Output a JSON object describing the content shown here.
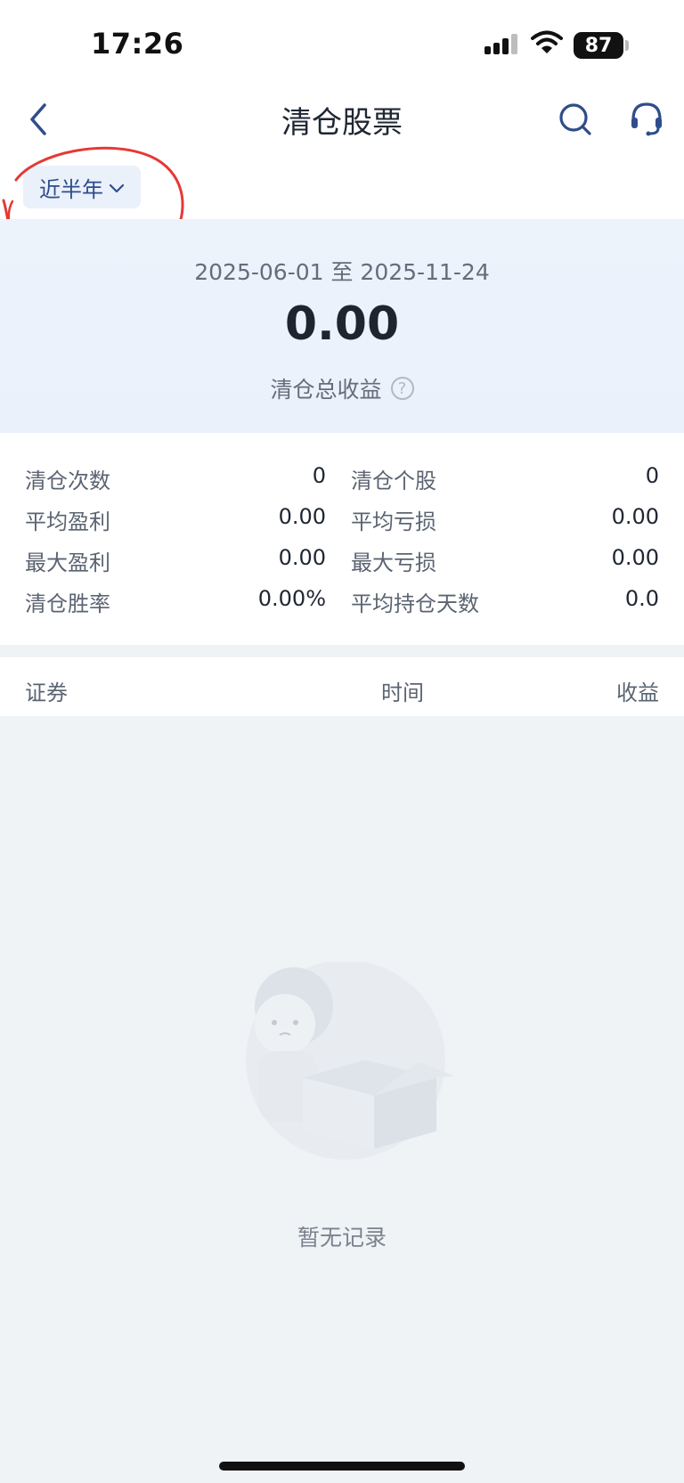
{
  "status_bar": {
    "time": "17:26",
    "battery": "87",
    "icons": [
      "signal-icon",
      "wifi-icon",
      "battery-icon"
    ]
  },
  "nav": {
    "title": "清仓股票",
    "icons": [
      "back-icon",
      "search-icon",
      "headset-service-icon"
    ]
  },
  "filter": {
    "period_label": "近半年",
    "dropdown_icon": "chevron-down-icon"
  },
  "summary": {
    "date_range": "2025-06-01 至 2025-11-24",
    "total_value": "0.00",
    "total_label": "清仓总收益",
    "help_glyph": "?"
  },
  "stats": [
    {
      "label": "清仓次数",
      "value": "0"
    },
    {
      "label": "清仓个股",
      "value": "0"
    },
    {
      "label": "平均盈利",
      "value": "0.00"
    },
    {
      "label": "平均亏损",
      "value": "0.00"
    },
    {
      "label": "最大盈利",
      "value": "0.00"
    },
    {
      "label": "最大亏损",
      "value": "0.00"
    },
    {
      "label": "清仓胜率",
      "value": "0.00%"
    },
    {
      "label": "平均持仓天数",
      "value": "0.0"
    }
  ],
  "table": {
    "columns": [
      "证券",
      "时间",
      "收益"
    ]
  },
  "empty_state": {
    "text": "暂无记录",
    "illustration": "lion-mascot-with-empty-box"
  },
  "colors": {
    "accent": "#2f4d8a",
    "annotation": "#e53935",
    "page_bg": "#f0f3f6"
  }
}
